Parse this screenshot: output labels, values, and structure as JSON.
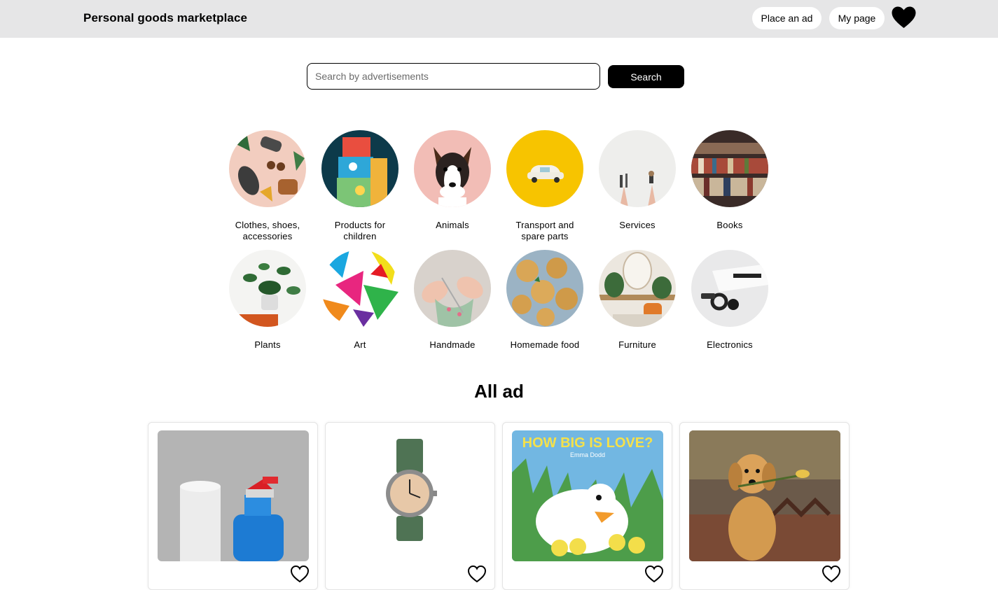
{
  "header": {
    "brand": "Personal goods marketplace",
    "place_ad_label": "Place an ad",
    "my_page_label": "My page",
    "favorites_icon": "heart-icon"
  },
  "search": {
    "placeholder": "Search by advertisements",
    "value": "",
    "button_label": "Search"
  },
  "categories": [
    {
      "label": "Clothes, shoes, accessories"
    },
    {
      "label": "Products for children"
    },
    {
      "label": "Animals"
    },
    {
      "label": "Transport and spare parts"
    },
    {
      "label": "Services"
    },
    {
      "label": "Books"
    },
    {
      "label": "Plants"
    },
    {
      "label": "Art"
    },
    {
      "label": "Handmade"
    },
    {
      "label": "Homemade food"
    },
    {
      "label": "Furniture"
    },
    {
      "label": "Electronics"
    }
  ],
  "ads_section": {
    "title": "All ad",
    "cards": [
      {
        "image": "cleaning-supplies",
        "favorite_icon": "heart-outline-icon"
      },
      {
        "image": "wristwatch",
        "favorite_icon": "heart-outline-icon"
      },
      {
        "image": "book-cover",
        "book_title": "HOW BIG IS LOVE?",
        "book_author": "Emma Dodd",
        "favorite_icon": "heart-outline-icon"
      },
      {
        "image": "puppy",
        "favorite_icon": "heart-outline-icon"
      }
    ]
  },
  "colors": {
    "header_bg": "#e6e6e7",
    "button_dark": "#000000",
    "page_bg": "#ffffff"
  }
}
